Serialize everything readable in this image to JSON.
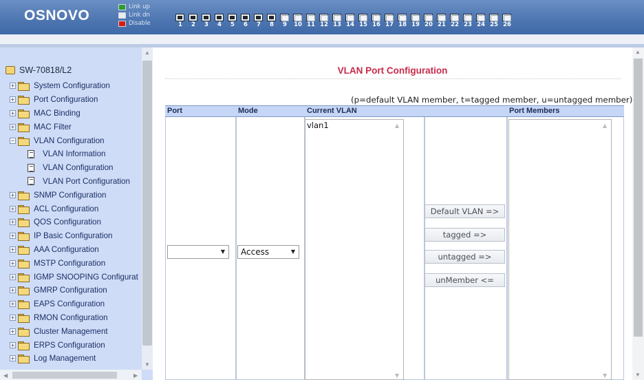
{
  "header": {
    "logo": "OSNOVO",
    "legend": [
      {
        "label": "Link up",
        "icon": "link-up-icon"
      },
      {
        "label": "Link dn",
        "icon": "link-down-icon"
      },
      {
        "label": "Disable",
        "icon": "disable-icon"
      }
    ],
    "ports": [
      {
        "num": "1",
        "state": "up"
      },
      {
        "num": "2",
        "state": "up"
      },
      {
        "num": "3",
        "state": "up"
      },
      {
        "num": "4",
        "state": "up"
      },
      {
        "num": "5",
        "state": "up"
      },
      {
        "num": "6",
        "state": "up"
      },
      {
        "num": "7",
        "state": "up"
      },
      {
        "num": "8",
        "state": "up"
      },
      {
        "num": "9",
        "state": "dn"
      },
      {
        "num": "10",
        "state": "dn"
      },
      {
        "num": "11",
        "state": "dn"
      },
      {
        "num": "12",
        "state": "dn"
      },
      {
        "num": "13",
        "state": "dn"
      },
      {
        "num": "14",
        "state": "dn"
      },
      {
        "num": "15",
        "state": "dn"
      },
      {
        "num": "16",
        "state": "dn"
      },
      {
        "num": "17",
        "state": "dn"
      },
      {
        "num": "18",
        "state": "dn"
      },
      {
        "num": "19",
        "state": "dn"
      },
      {
        "num": "20",
        "state": "dn"
      },
      {
        "num": "21",
        "state": "dn"
      },
      {
        "num": "22",
        "state": "dn"
      },
      {
        "num": "23",
        "state": "dn"
      },
      {
        "num": "24",
        "state": "dn"
      },
      {
        "num": "25",
        "state": "dn"
      },
      {
        "num": "26",
        "state": "dn"
      }
    ]
  },
  "nav": {
    "root": "SW-70818/L2",
    "items": [
      {
        "label": "System Configuration",
        "type": "folder",
        "expanded": false
      },
      {
        "label": "Port Configuration",
        "type": "folder",
        "expanded": false
      },
      {
        "label": "MAC Binding",
        "type": "folder",
        "expanded": false
      },
      {
        "label": "MAC Filter",
        "type": "folder",
        "expanded": false
      },
      {
        "label": "VLAN Configuration",
        "type": "folder",
        "expanded": true
      },
      {
        "label": "VLAN Information",
        "type": "page"
      },
      {
        "label": "VLAN Configuration",
        "type": "page"
      },
      {
        "label": "VLAN Port Configuration",
        "type": "page"
      },
      {
        "label": "SNMP Configuration",
        "type": "folder",
        "expanded": false
      },
      {
        "label": "ACL Configuration",
        "type": "folder",
        "expanded": false
      },
      {
        "label": "QOS Configuration",
        "type": "folder",
        "expanded": false
      },
      {
        "label": "IP Basic Configuration",
        "type": "folder",
        "expanded": false
      },
      {
        "label": "AAA Configuration",
        "type": "folder",
        "expanded": false
      },
      {
        "label": "MSTP Configuration",
        "type": "folder",
        "expanded": false
      },
      {
        "label": "IGMP SNOOPING Configurat",
        "type": "folder",
        "expanded": false
      },
      {
        "label": "GMRP Configuration",
        "type": "folder",
        "expanded": false
      },
      {
        "label": "EAPS Configuration",
        "type": "folder",
        "expanded": false
      },
      {
        "label": "RMON Configuration",
        "type": "folder",
        "expanded": false
      },
      {
        "label": "Cluster Management",
        "type": "folder",
        "expanded": false
      },
      {
        "label": "ERPS Configuration",
        "type": "folder",
        "expanded": false
      },
      {
        "label": "Log Management",
        "type": "folder",
        "expanded": false
      }
    ]
  },
  "main": {
    "title": "VLAN Port Configuration",
    "hint": "(p=default VLAN member, t=tagged member, u=untagged member)",
    "columns": {
      "port": "Port",
      "mode": "Mode",
      "current_vlan": "Current VLAN",
      "port_members": "Port Members"
    },
    "port_select": "",
    "mode_select": "Access",
    "current_vlan_items": [
      "vlan1"
    ],
    "buttons": {
      "default_vlan": "Default  VLAN =>",
      "tagged": "tagged =>",
      "untagged": "untagged =>",
      "unmember": "unMember <="
    }
  },
  "colors": {
    "header": "#4d75b0",
    "nav_bg": "#cfdcf7",
    "title": "#c72a4a",
    "col_head": "#c5d6f6"
  }
}
